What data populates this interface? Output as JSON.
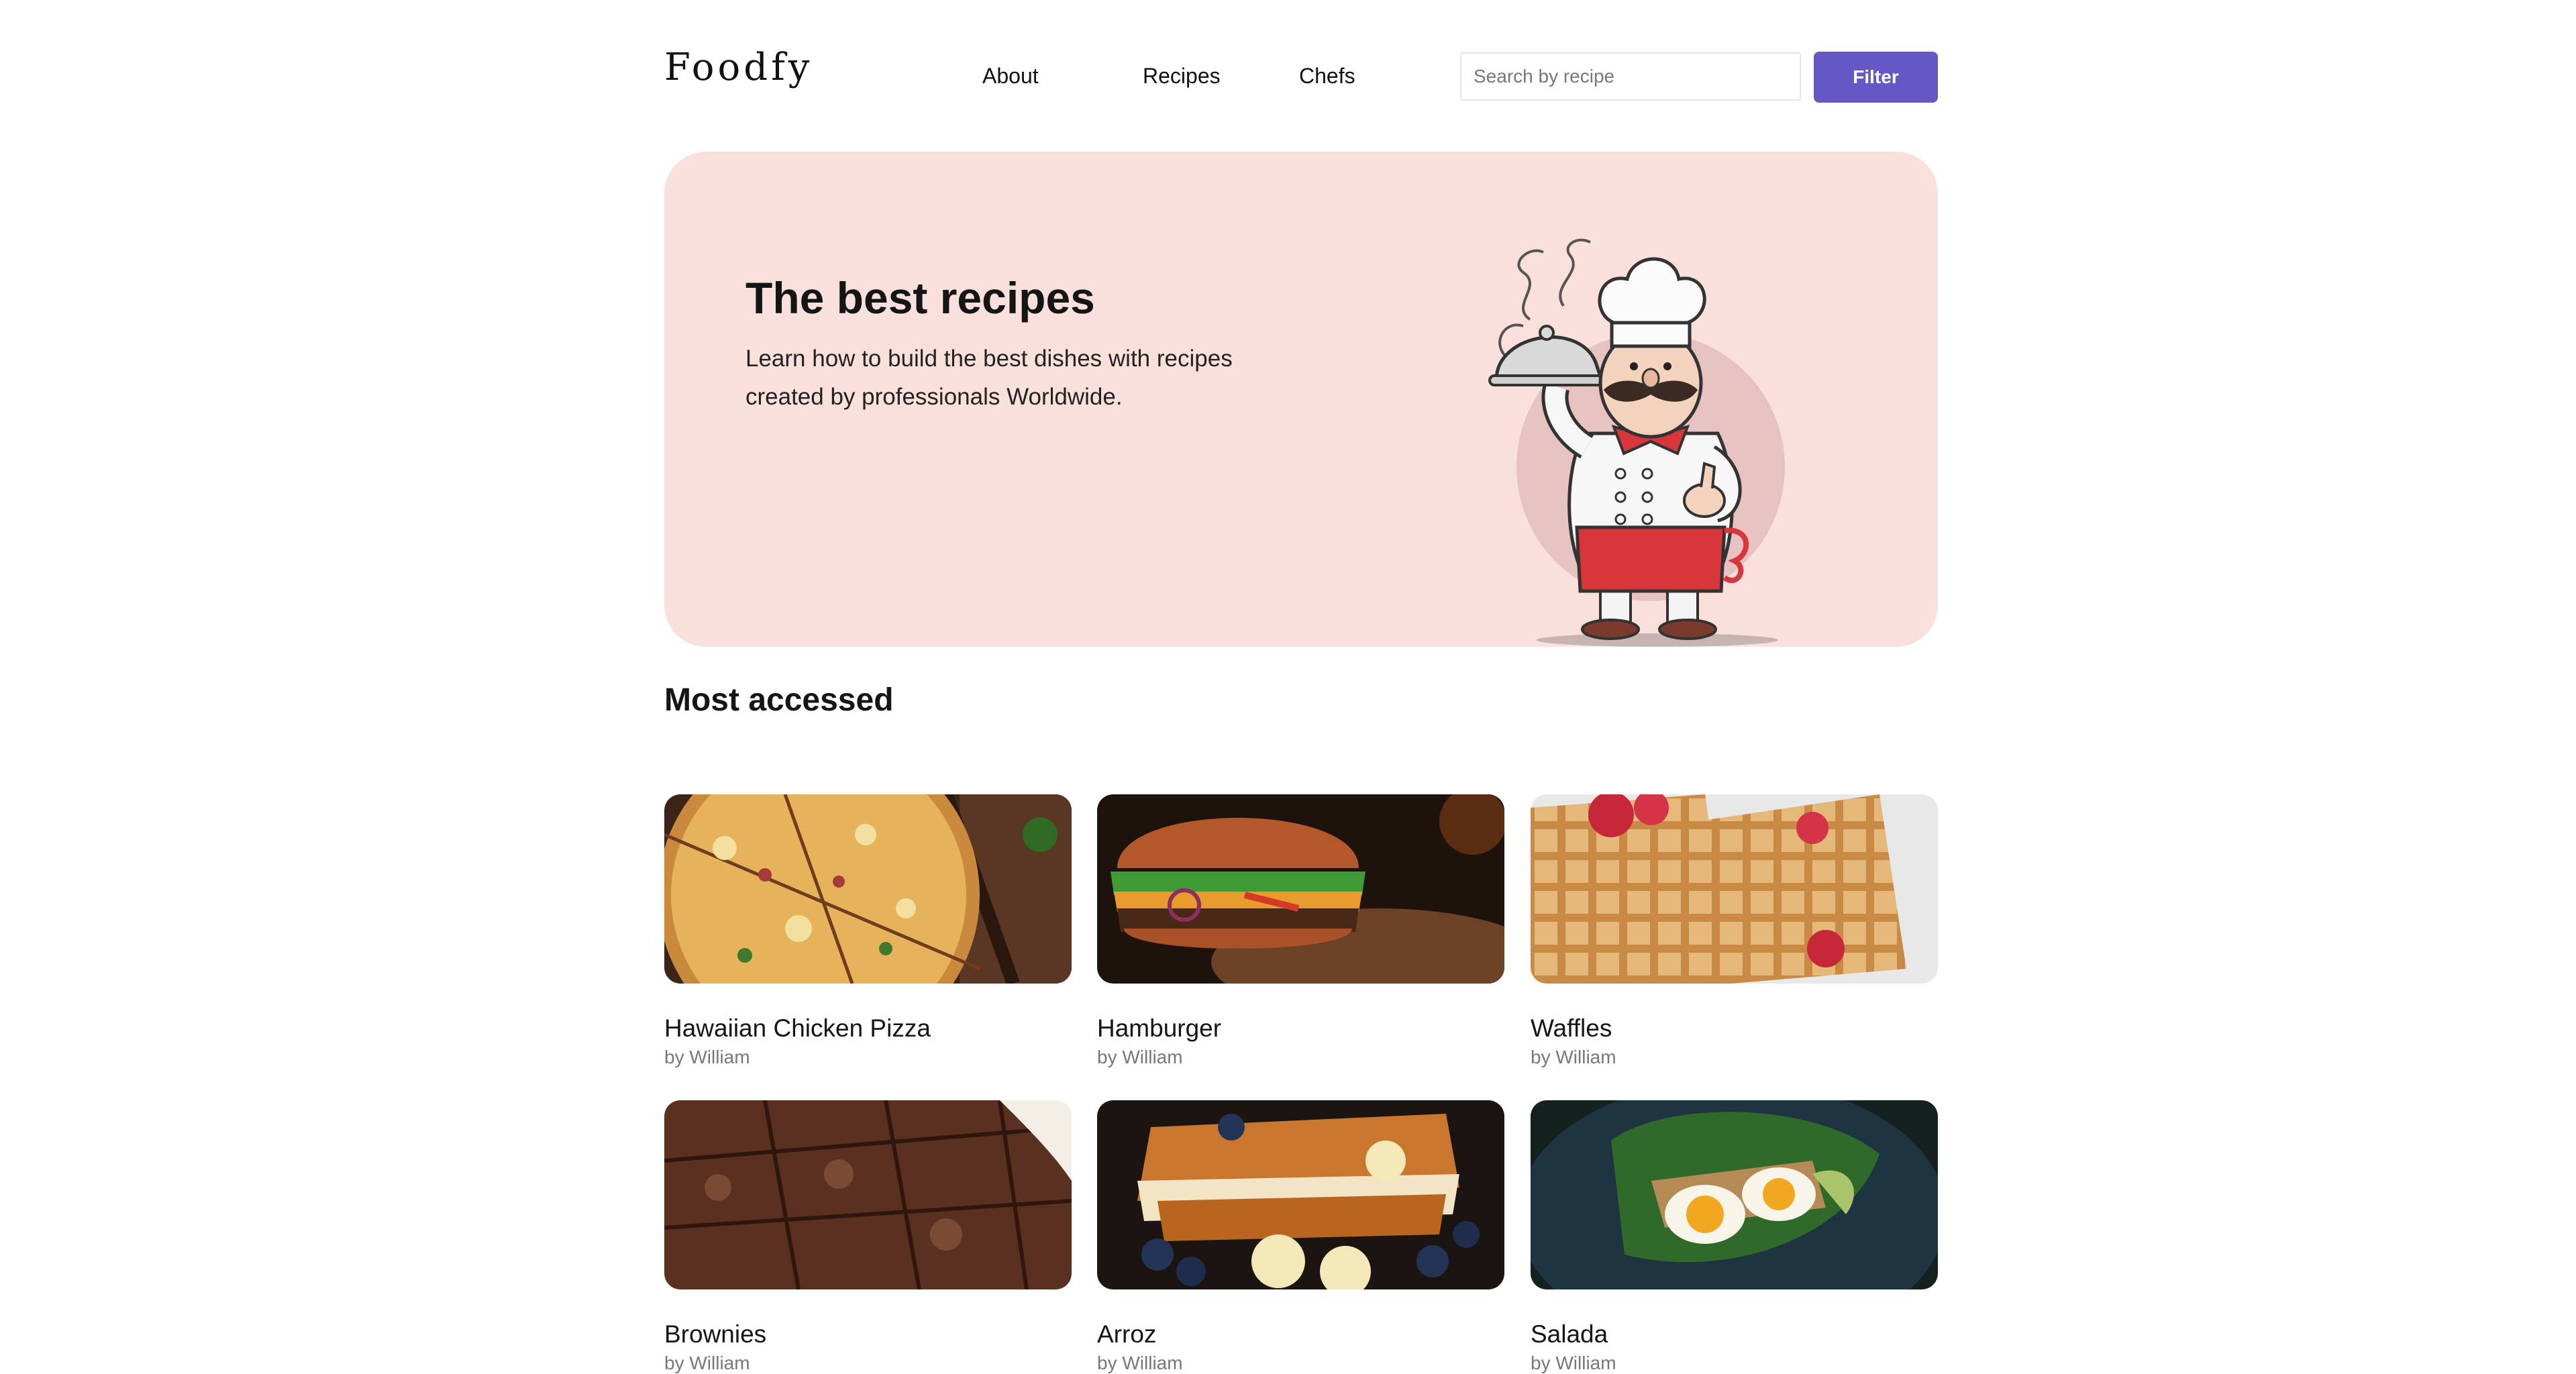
{
  "header": {
    "logo": "Foodfy",
    "nav": [
      {
        "label": "About"
      },
      {
        "label": "Recipes"
      },
      {
        "label": "Chefs"
      }
    ],
    "search": {
      "placeholder": "Search by recipe",
      "value": ""
    },
    "filter_label": "Filter",
    "accent_color": "#6558c5"
  },
  "hero": {
    "title": "The best recipes",
    "text": "Learn how to build the best dishes with recipes created by professionals Worldwide.",
    "background_color": "#fae0dc",
    "illustration": "chef-illustration"
  },
  "section": {
    "title": "Most accessed"
  },
  "recipes": [
    {
      "title": "Hawaiian Chicken Pizza",
      "author": "by William",
      "image": "pizza-photo"
    },
    {
      "title": "Hamburger",
      "author": "by William",
      "image": "hamburger-photo"
    },
    {
      "title": "Waffles",
      "author": "by William",
      "image": "waffles-photo"
    },
    {
      "title": "Brownies",
      "author": "by William",
      "image": "brownies-photo"
    },
    {
      "title": "Arroz",
      "author": "by William",
      "image": "arroz-photo"
    },
    {
      "title": "Salada",
      "author": "by William",
      "image": "salada-photo"
    }
  ]
}
